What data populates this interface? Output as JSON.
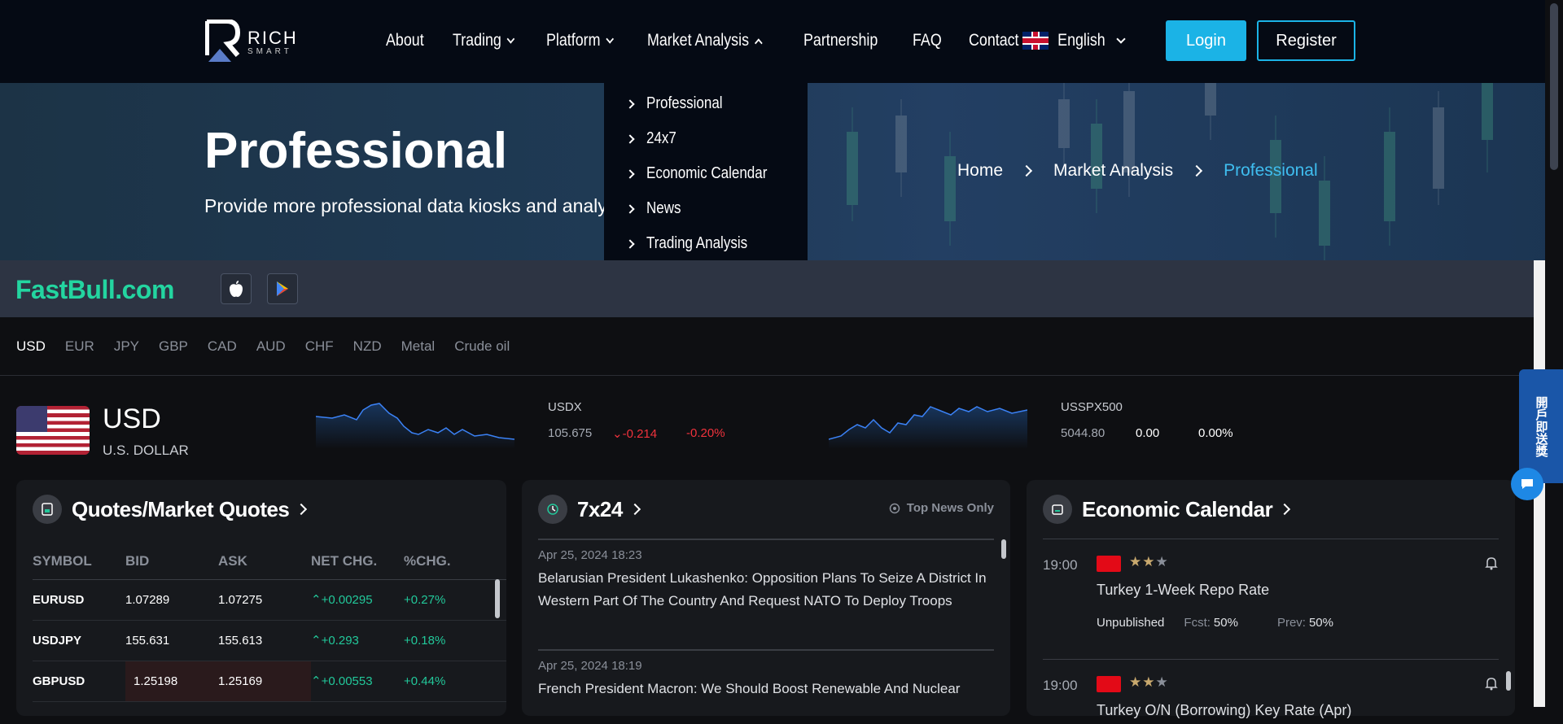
{
  "brand": {
    "top": "RICH",
    "bottom": "SMART"
  },
  "nav": {
    "items": [
      "About",
      "Trading",
      "Platform",
      "Market Analysis",
      "Partnership",
      "FAQ",
      "Contact"
    ],
    "language": "English",
    "login": "Login",
    "register": "Register"
  },
  "dropdown": [
    "Professional",
    "24x7",
    "Economic Calendar",
    "News",
    "Trading Analysis"
  ],
  "hero": {
    "title": "Professional",
    "subtitle": "Provide more professional data kiosks and analysis tools.",
    "breadcrumb": [
      "Home",
      "Market Analysis",
      "Professional"
    ]
  },
  "fastbull": {
    "logo": "FastBull.com"
  },
  "currency_tabs": [
    "USD",
    "EUR",
    "JPY",
    "GBP",
    "CAD",
    "AUD",
    "CHF",
    "NZD",
    "Metal",
    "Crude oil"
  ],
  "usd": {
    "code": "USD",
    "name": "U.S. DOLLAR",
    "usdx": {
      "name": "USDX",
      "value": "105.675",
      "change": "-0.214",
      "pct": "-0.20%"
    },
    "usspx": {
      "name": "USSPX500",
      "value": "5044.80",
      "change": "0.00",
      "pct": "0.00%"
    }
  },
  "quotes": {
    "title": "Quotes/Market Quotes",
    "headers": [
      "SYMBOL",
      "BID",
      "ASK",
      "NET CHG.",
      "%CHG."
    ],
    "rows": [
      {
        "symbol": "EURUSD",
        "bid": "1.07289",
        "ask": "1.07275",
        "chg": "+0.00295",
        "pct": "+0.27%"
      },
      {
        "symbol": "USDJPY",
        "bid": "155.631",
        "ask": "155.613",
        "chg": "+0.293",
        "pct": "+0.18%"
      },
      {
        "symbol": "GBPUSD",
        "bid": "1.25198",
        "ask": "1.25169",
        "chg": "+0.00553",
        "pct": "+0.44%"
      }
    ]
  },
  "news": {
    "title": "7x24",
    "filter": "Top News Only",
    "items": [
      {
        "time": "Apr 25, 2024 18:23",
        "title": "Belarusian President Lukashenko: Opposition Plans To Seize A District In Western Part Of The Country And Request NATO To Deploy Troops"
      },
      {
        "time": "Apr 25, 2024 18:19",
        "title": "French President Macron: We Should Boost Renewable And Nuclear"
      }
    ]
  },
  "calendar": {
    "title": "Economic Calendar",
    "items": [
      {
        "time": "19:00",
        "title": "Turkey 1-Week Repo Rate",
        "status": "Unpublished",
        "fcst_label": "Fcst:",
        "fcst": "50%",
        "prev_label": "Prev:",
        "prev": "50%",
        "stars": "★★★"
      },
      {
        "time": "19:00",
        "title": "Turkey O/N (Borrowing) Key Rate (Apr)",
        "stars": "★★★"
      }
    ]
  },
  "side_tab": "開戶即送獎",
  "colors": {
    "accent": "#1bb3e6",
    "up": "#22c89a",
    "down": "#f0323c",
    "fastbull": "#23d5a0"
  }
}
